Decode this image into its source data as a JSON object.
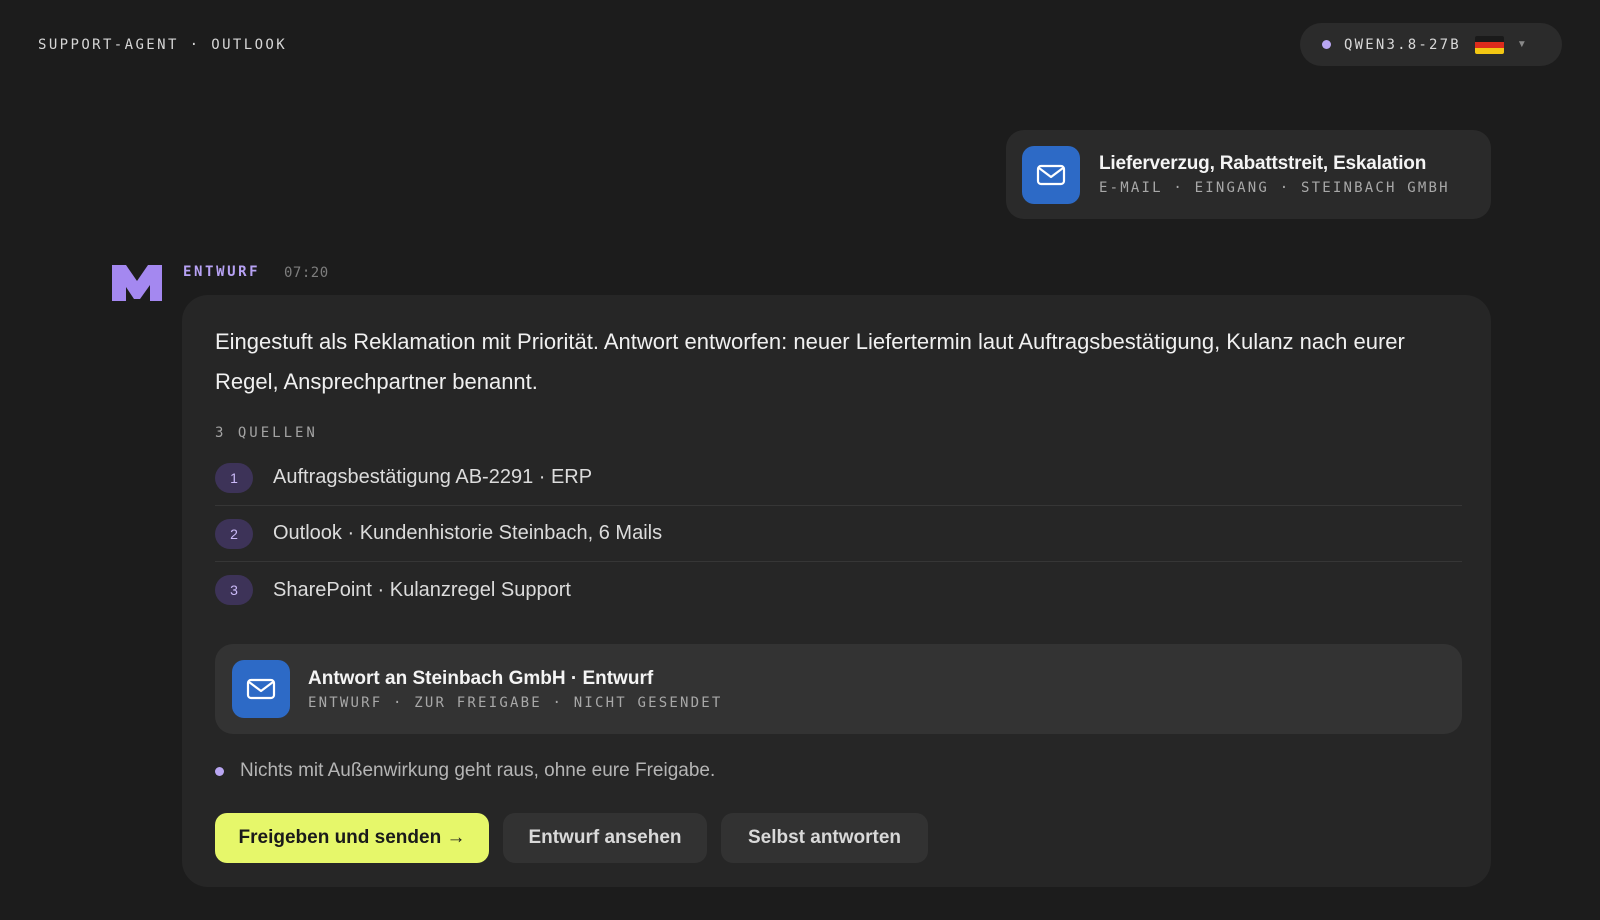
{
  "app_title": "SUPPORT-AGENT · OUTLOOK",
  "model_selector": {
    "name": "QWEN3.8-27B",
    "flag_colors": [
      "#1a1a1a",
      "#dd2b1c",
      "#f3c713"
    ],
    "status_color": "#b9a6f2"
  },
  "attachment": {
    "icon": "mail-icon",
    "title": "Lieferverzug, Rabattstreit, Eskalation",
    "meta": "E-MAIL · EINGANG · STEINBACH GMBH"
  },
  "message": {
    "label": "ENTWURF",
    "time": "07:20",
    "body": "Eingestuft als Reklamation mit Priorität. Antwort entworfen: neuer Liefertermin laut Auftragsbestätigung, Kulanz nach eurer Regel, Ansprechpartner benannt.",
    "sources_heading": "3 QUELLEN",
    "sources": [
      {
        "num": "1",
        "text": "Auftragsbestätigung AB-2291 · ERP"
      },
      {
        "num": "2",
        "text": "Outlook · Kundenhistorie Steinbach, 6 Mails"
      },
      {
        "num": "3",
        "text": "SharePoint · Kulanzregel Support"
      }
    ],
    "draft": {
      "icon": "mail-icon",
      "title": "Antwort an Steinbach GmbH · Entwurf",
      "meta": "ENTWURF · ZUR FREIGABE · NICHT GESENDET"
    },
    "note": "Nichts mit Außenwirkung geht raus, ohne eure Freigabe.",
    "actions": {
      "primary": "Freigeben und senden →",
      "view": "Entwurf ansehen",
      "self": "Selbst antworten"
    }
  },
  "colors": {
    "accent_purple": "#b7a2f4",
    "mail_blue": "#2d6ac6",
    "primary_button": "#e6f76a"
  }
}
